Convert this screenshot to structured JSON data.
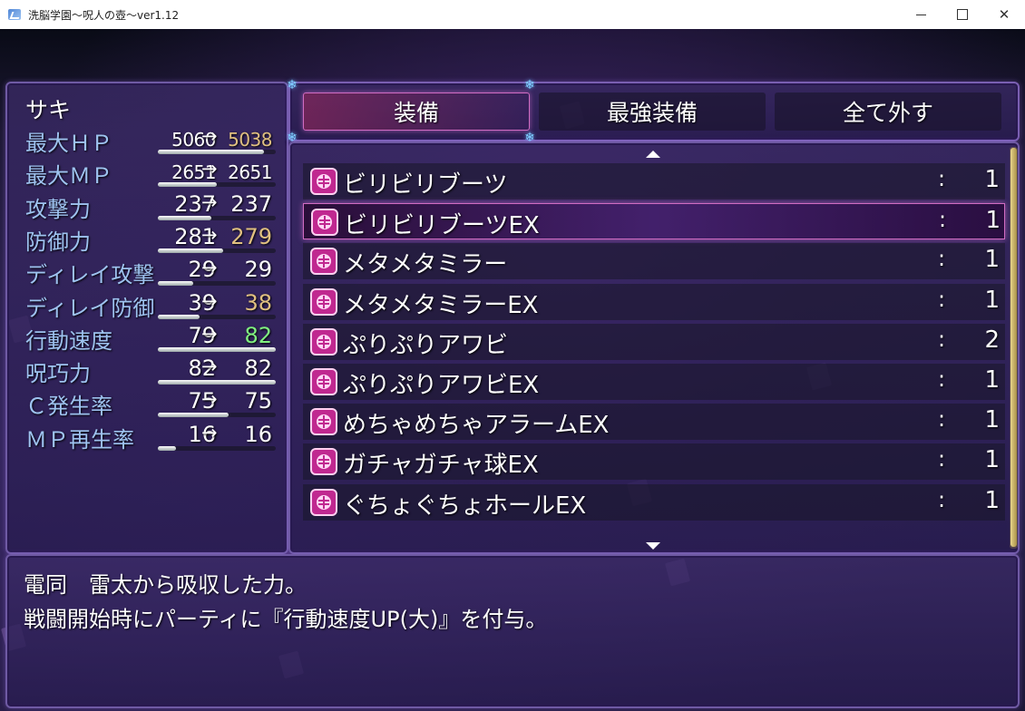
{
  "window": {
    "title": "洗脳学園～呪人の壺～ver1.12",
    "minimize_symbol": "",
    "close_symbol": "✕"
  },
  "status": {
    "actor_name": "サキ",
    "stats": [
      {
        "label": "最大ＨＰ",
        "old": "5060",
        "new": "5038",
        "new_color": "#e0c080",
        "gauge": 0.9,
        "small": true
      },
      {
        "label": "最大ＭＰ",
        "old": "2651",
        "new": "2651",
        "new_color": "#ffffff",
        "gauge": 0.5,
        "small": true
      },
      {
        "label": "攻撃力",
        "old": "237",
        "new": "237",
        "new_color": "#ffffff",
        "gauge": 0.45,
        "small": false
      },
      {
        "label": "防御力",
        "old": "281",
        "new": "279",
        "new_color": "#e0c080",
        "gauge": 0.55,
        "small": false
      },
      {
        "label": "ディレイ攻撃",
        "old": "29",
        "new": "29",
        "new_color": "#ffffff",
        "gauge": 0.3,
        "small": false
      },
      {
        "label": "ディレイ防御",
        "old": "39",
        "new": "38",
        "new_color": "#e0c080",
        "gauge": 0.35,
        "small": false
      },
      {
        "label": "行動速度",
        "old": "79",
        "new": "82",
        "new_color": "#80f080",
        "gauge": 1.0,
        "small": false
      },
      {
        "label": "呪巧力",
        "old": "82",
        "new": "82",
        "new_color": "#ffffff",
        "gauge": 1.0,
        "small": false
      },
      {
        "label": "Ｃ発生率",
        "old": "75",
        "new": "75",
        "new_color": "#ffffff",
        "gauge": 0.6,
        "small": false
      },
      {
        "label": "ＭＰ再生率",
        "old": "16",
        "new": "16",
        "new_color": "#ffffff",
        "gauge": 0.15,
        "small": false
      }
    ],
    "arrow": "→"
  },
  "commands": {
    "equip": "装備",
    "optimize": "最強装備",
    "clear": "全て外す"
  },
  "items": [
    {
      "name": "ビリビリブーツ",
      "count": "1"
    },
    {
      "name": "ビリビリブーツEX",
      "count": "1",
      "selected": true
    },
    {
      "name": "メタメタミラー",
      "count": "1"
    },
    {
      "name": "メタメタミラーEX",
      "count": "1"
    },
    {
      "name": "ぷりぷりアワビ",
      "count": "2"
    },
    {
      "name": "ぷりぷりアワビEX",
      "count": "1"
    },
    {
      "name": "めちゃめちゃアラームEX",
      "count": "1"
    },
    {
      "name": "ガチャガチャ球EX",
      "count": "1"
    },
    {
      "name": "ぐちょぐちょホールEX",
      "count": "1"
    }
  ],
  "item_separator": ":",
  "help": {
    "line1": "電同　雷太から吸収した力。",
    "line2": "戦闘開始時にパーティに『行動速度UP(大)』を付与。"
  },
  "icons": {
    "item_icon": "brain-icon",
    "scroll_up": "scroll-up-arrow-icon",
    "scroll_down": "scroll-down-arrow-icon"
  },
  "colors": {
    "stat_label": "#9ec3f0",
    "stat_down": "#e0c080",
    "stat_up": "#80f080",
    "selection_border": "#d06cc2"
  }
}
